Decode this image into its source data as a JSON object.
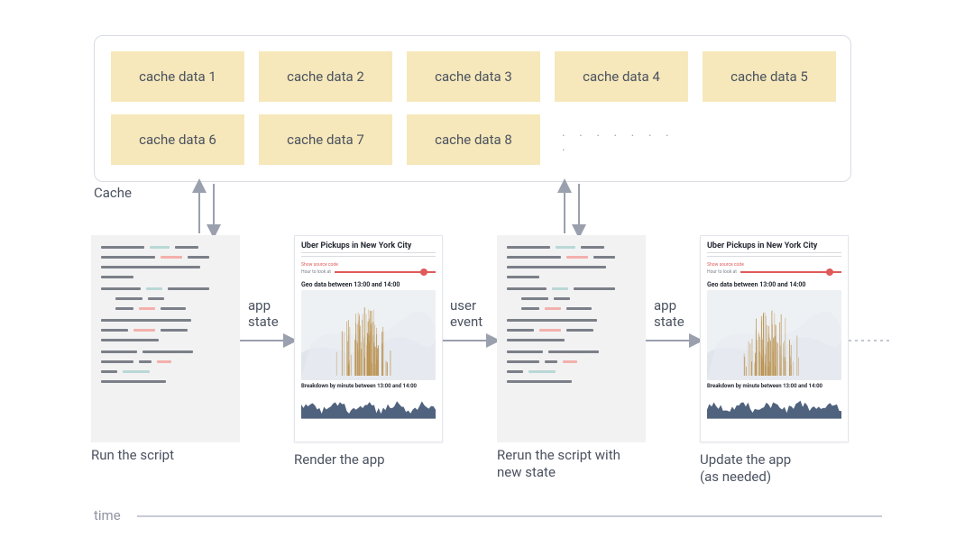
{
  "cache": {
    "label": "Cache",
    "cells": [
      "cache data 1",
      "cache data 2",
      "cache data 3",
      "cache data 4",
      "cache data 5",
      "cache data 6",
      "cache data 7",
      "cache data 8"
    ],
    "ellipsis": ". . . . . . . ."
  },
  "steps": {
    "run": {
      "label": "Run the script"
    },
    "render": {
      "label": "Render the app"
    },
    "rerun": {
      "label": "Rerun the script with\nnew state"
    },
    "update": {
      "label": "Update the app\n(as needed)"
    }
  },
  "arrows": {
    "app_state_1": "app\nstate",
    "user_event": "user\nevent",
    "app_state_2": "app\nstate"
  },
  "app_demo": {
    "title": "Uber Pickups in New York City",
    "link_text": "Show source code",
    "slider_label": "Hour to look at",
    "geo_subtitle": "Geo data between 13:00 and 14:00",
    "breakdown_subtitle": "Breakdown by minute between 13:00 and 14:00"
  },
  "time": {
    "label": "time"
  },
  "colors": {
    "cache_bg": "#f6e8ba",
    "text": "#4b5260",
    "accent": "#e05a5a",
    "chart_fill": "#4f627e",
    "map_spike": "#b98f4a",
    "arrow": "#9aa0ad"
  }
}
